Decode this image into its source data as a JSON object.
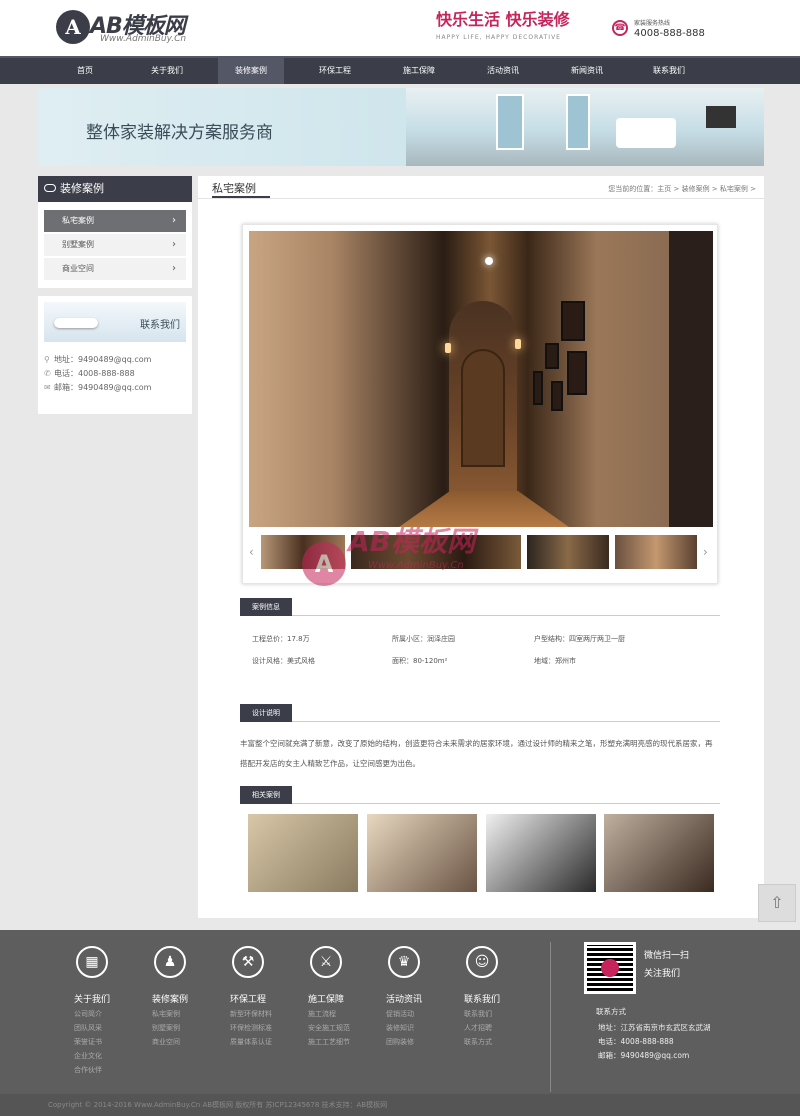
{
  "header": {
    "logo_mark": "A",
    "logo_text": "AB模板网",
    "logo_sub": "Www.AdminBuy.Cn",
    "slogan": "快乐生活 快乐装修",
    "slogan_en": "HAPPY LIFE, HAPPY DECORATIVE",
    "hotline_label": "家装服务热线",
    "hotline_number": "4008-888-888"
  },
  "nav": {
    "items": [
      "首页",
      "关于我们",
      "装修案例",
      "环保工程",
      "施工保障",
      "活动资讯",
      "新闻资讯",
      "联系我们"
    ],
    "active_index": 2
  },
  "banner": {
    "text": "整体家装解决方案服务商"
  },
  "sidebar": {
    "title": "装修案例",
    "items": [
      "私宅案例",
      "别墅案例",
      "商业空间"
    ],
    "active_index": 0
  },
  "contact_box": {
    "title": "联系我们",
    "address": "地址：9490489@qq.com",
    "phone": "电话：4008-888-888",
    "email": "邮箱：9490489@qq.com"
  },
  "main": {
    "title": "私宅案例",
    "breadcrumb": "您当前的位置：主页 > 装修案例 > 私宅案例 >"
  },
  "case_info": {
    "heading": "案例信息",
    "fields": [
      "工程总价：17.8万",
      "所属小区：润泽庄园",
      "户型结构：四室两厅两卫一厨",
      "设计风格：美式风格",
      "面积：80-120m²",
      "地域：郑州市"
    ]
  },
  "design": {
    "heading": "设计说明",
    "text": "丰富整个空间就充满了新意，改变了原始的结构，创造更符合未来需求的居家环境，通过设计师的精来之笔，形塑充满明亮感的现代系居家，再搭配开发店的女主人精致艺作品，让空间感更为出色。"
  },
  "related": {
    "heading": "相关案例"
  },
  "watermark": {
    "mark": "A",
    "text": "AB模板网",
    "sub": "Www.AdminBuy.Cn"
  },
  "gallery": {
    "prev": "‹",
    "next": "›"
  },
  "footer": {
    "columns": [
      {
        "icon": "▦",
        "title": "关于我们",
        "links": [
          "公司简介",
          "团队风采",
          "荣誉证书",
          "企业文化",
          "合作伙伴"
        ]
      },
      {
        "icon": "♟",
        "title": "装修案例",
        "links": [
          "私宅案例",
          "别墅案例",
          "商业空间"
        ]
      },
      {
        "icon": "⚒",
        "title": "环保工程",
        "links": [
          "新型环保材料",
          "环保检测标准",
          "质量体系认证"
        ]
      },
      {
        "icon": "⚔",
        "title": "施工保障",
        "links": [
          "施工流程",
          "安全施工规范",
          "施工工艺细节"
        ]
      },
      {
        "icon": "♛",
        "title": "活动资讯",
        "links": [
          "促销活动",
          "装修知识",
          "团购装修"
        ]
      },
      {
        "icon": "☺",
        "title": "联系我们",
        "links": [
          "联系我们",
          "人才招聘",
          "联系方式"
        ]
      }
    ],
    "wechat_1": "微信扫一扫",
    "wechat_2": "关注我们",
    "contact_title": "联系方式",
    "address": "地址：江苏省南京市玄武区玄武湖",
    "phone": "电话：4008-888-888",
    "email": "邮箱：9490489@qq.com",
    "copyright": "Copyright © 2014-2016 Www.AdminBuy.Cn AB模板网 版权所有          苏ICP12345678          技术支持：AB模板网"
  },
  "totop": "⇧",
  "colors": {
    "primary": "#3b3e48",
    "accent": "#c8245c",
    "footer": "#5e5e5e"
  }
}
